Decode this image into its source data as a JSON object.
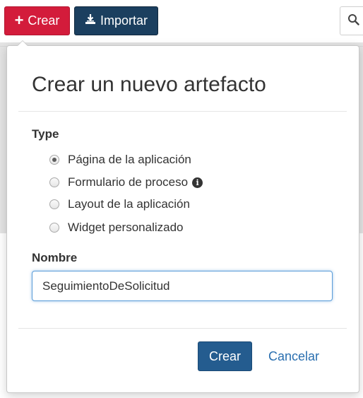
{
  "toolbar": {
    "create_label": "Crear",
    "import_label": "Importar",
    "icons": {
      "create": "plus-icon",
      "import": "import-icon",
      "search": "search-icon"
    }
  },
  "dialog": {
    "title": "Crear un nuevo artefacto",
    "type_label": "Type",
    "type_options": [
      {
        "label": "Página de la aplicación",
        "selected": true
      },
      {
        "label": "Formulario de proceso",
        "selected": false,
        "info_icon": "info-icon"
      },
      {
        "label": "Layout de la aplicación",
        "selected": false
      },
      {
        "label": "Widget personalizado",
        "selected": false
      }
    ],
    "name_label": "Nombre",
    "name_value": "SeguimientoDeSolicitud",
    "submit_label": "Crear",
    "cancel_label": "Cancelar"
  },
  "colors": {
    "create_button": "#d31c3b",
    "import_button": "#1b3f5f",
    "primary_button": "#245c8f",
    "link": "#2a6fb0",
    "input_focus": "#5b9dd9"
  }
}
